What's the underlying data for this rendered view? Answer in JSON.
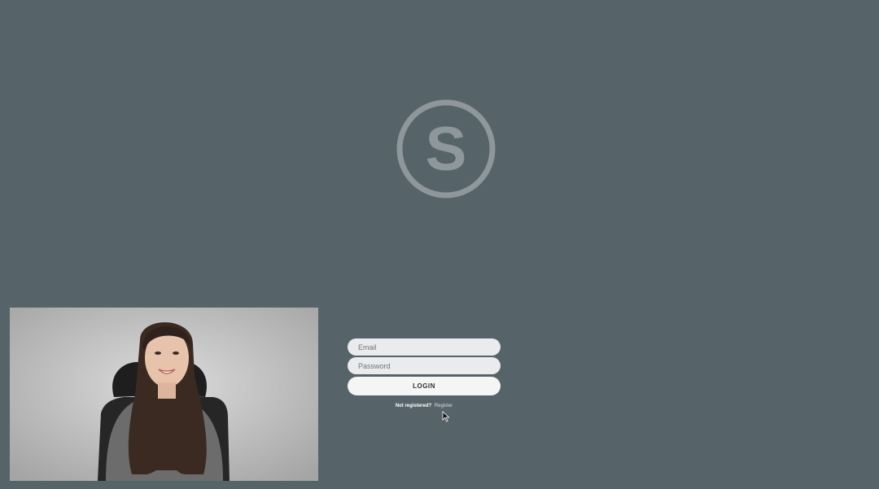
{
  "brand": {
    "logo_letter": "S",
    "logo_color": "#8e979b"
  },
  "webcam": {
    "icon": "person-video-icon"
  },
  "login": {
    "email_placeholder": "Email",
    "password_placeholder": "Password",
    "login_label": "LOGIN",
    "not_registered_text": "Not registered?",
    "register_link_text": "Register"
  },
  "colors": {
    "background": "#566469",
    "input_bg": "#e9ebec",
    "button_bg": "#f4f5f5"
  }
}
